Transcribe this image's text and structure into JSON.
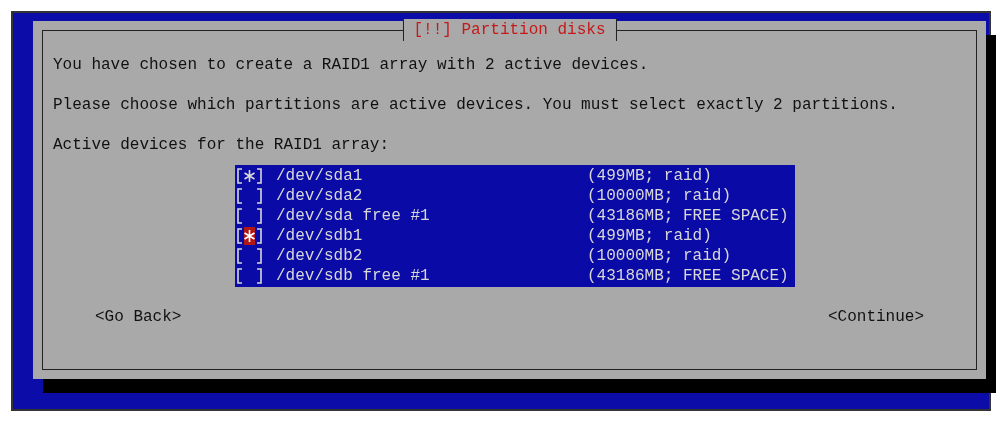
{
  "dialog": {
    "title": "[!!] Partition disks",
    "paragraphs": [
      "You have chosen to create a RAID1 array with 2 active devices.",
      "Please choose which partitions are active devices. You must select exactly 2 partitions.",
      "Active devices for the RAID1 array:"
    ],
    "devices": [
      {
        "name": "/dev/sda1",
        "size": "(499MB; raid)",
        "checked": true,
        "focused": false
      },
      {
        "name": "/dev/sda2",
        "size": "(10000MB; raid)",
        "checked": false,
        "focused": false
      },
      {
        "name": "/dev/sda free #1",
        "size": "(43186MB; FREE SPACE)",
        "checked": false,
        "focused": false
      },
      {
        "name": "/dev/sdb1",
        "size": "(499MB; raid)",
        "checked": true,
        "focused": true
      },
      {
        "name": "/dev/sdb2",
        "size": "(10000MB; raid)",
        "checked": false,
        "focused": false
      },
      {
        "name": "/dev/sdb free #1",
        "size": "(43186MB; FREE SPACE)",
        "checked": false,
        "focused": false
      }
    ],
    "buttons": [
      "<Go Back>",
      "<Continue>"
    ]
  }
}
